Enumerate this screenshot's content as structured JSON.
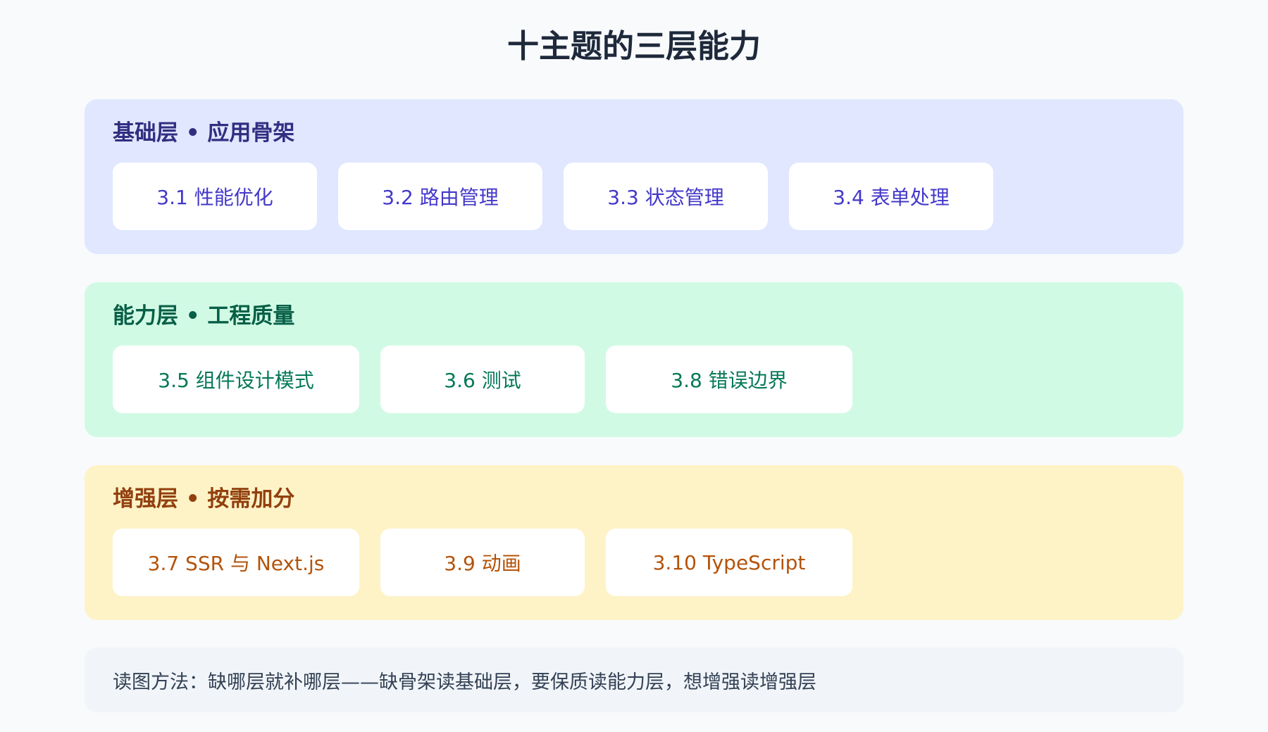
{
  "title": "十主题的三层能力",
  "layers": [
    {
      "title": "基础层 • 应用骨架",
      "bg": "#e0e7ff",
      "title_color": "#312e81",
      "card_color": "#4338ca",
      "cards": [
        "3.1 性能优化",
        "3.2 路由管理",
        "3.3 状态管理",
        "3.4 表单处理"
      ]
    },
    {
      "title": "能力层 • 工程质量",
      "bg": "#d1fae5",
      "title_color": "#065f46",
      "card_color": "#047857",
      "cards": [
        "3.5 组件设计模式",
        "3.6 测试",
        "3.8 错误边界"
      ]
    },
    {
      "title": "增强层 • 按需加分",
      "bg": "#fef3c7",
      "title_color": "#92400e",
      "card_color": "#b45309",
      "cards": [
        "3.7 SSR 与 Next.js",
        "3.9 动画",
        "3.10 TypeScript"
      ]
    }
  ],
  "note": "读图方法：缺哪层就补哪层——缺骨架读基础层，要保质读能力层，想增强读增强层"
}
